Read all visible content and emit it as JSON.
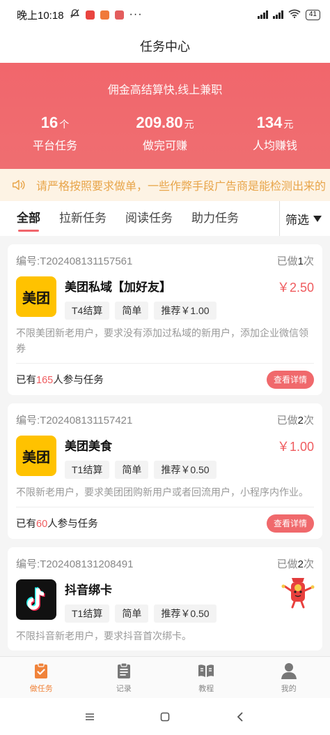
{
  "status_bar": {
    "time": "晚上10:18",
    "battery": "41"
  },
  "header": {
    "title": "任务中心"
  },
  "banner": {
    "slogan": "佣金高结算快,线上兼职",
    "stats": [
      {
        "value": "16",
        "unit": "个",
        "label": "平台任务"
      },
      {
        "value": "209.80",
        "unit": "元",
        "label": "做完可赚"
      },
      {
        "value": "134",
        "unit": "元",
        "label": "人均赚钱"
      }
    ]
  },
  "notice": {
    "text": "请严格按照要求做单，一些作弊手段广告商是能检测出来的"
  },
  "tabs": [
    {
      "label": "全部"
    },
    {
      "label": "拉新任务"
    },
    {
      "label": "阅读任务"
    },
    {
      "label": "助力任务"
    }
  ],
  "filter_label": "筛选",
  "tasks": [
    {
      "id_label": "编号:T202408131157561",
      "done_prefix": "已做",
      "done_count": "1",
      "done_suffix": "次",
      "logo_text": "美团",
      "name": "美团私域【加好友】",
      "price": "￥2.50",
      "tags": [
        "T4结算",
        "简单",
        "推荐￥1.00"
      ],
      "desc": "不限美团新老用户，要求没有添加过私域的新用户，添加企业微信领券",
      "join_prefix": "已有",
      "join_count": "165",
      "join_suffix": "人参与任务",
      "detail_label": "查看详情"
    },
    {
      "id_label": "编号:T202408131157421",
      "done_prefix": "已做",
      "done_count": "2",
      "done_suffix": "次",
      "logo_text": "美团",
      "name": "美团美食",
      "price": "￥1.00",
      "tags": [
        "T1结算",
        "简单",
        "推荐￥0.50"
      ],
      "desc": "不限新老用户，要求美团团购新用户或者回流用户，小程序内作业。",
      "join_prefix": "已有",
      "join_count": "60",
      "join_suffix": "人参与任务",
      "detail_label": "查看详情"
    },
    {
      "id_label": "编号:T202408131208491",
      "done_prefix": "已做",
      "done_count": "2",
      "done_suffix": "次",
      "name": "抖音绑卡",
      "tags": [
        "T1结算",
        "简单",
        "推荐￥0.50"
      ],
      "desc": "不限抖音新老用户，要求抖音首次绑卡。"
    }
  ],
  "tabbar": [
    {
      "label": "做任务",
      "icon": "clipboard-check-icon"
    },
    {
      "label": "记录",
      "icon": "list-doc-icon"
    },
    {
      "label": "教程",
      "icon": "book-icon"
    },
    {
      "label": "我的",
      "icon": "user-icon"
    }
  ],
  "colors": {
    "accent": "#f1666c",
    "notice_text": "#e8a54a",
    "tab_active": "#f0833a",
    "meituan_yellow": "#ffc200"
  }
}
